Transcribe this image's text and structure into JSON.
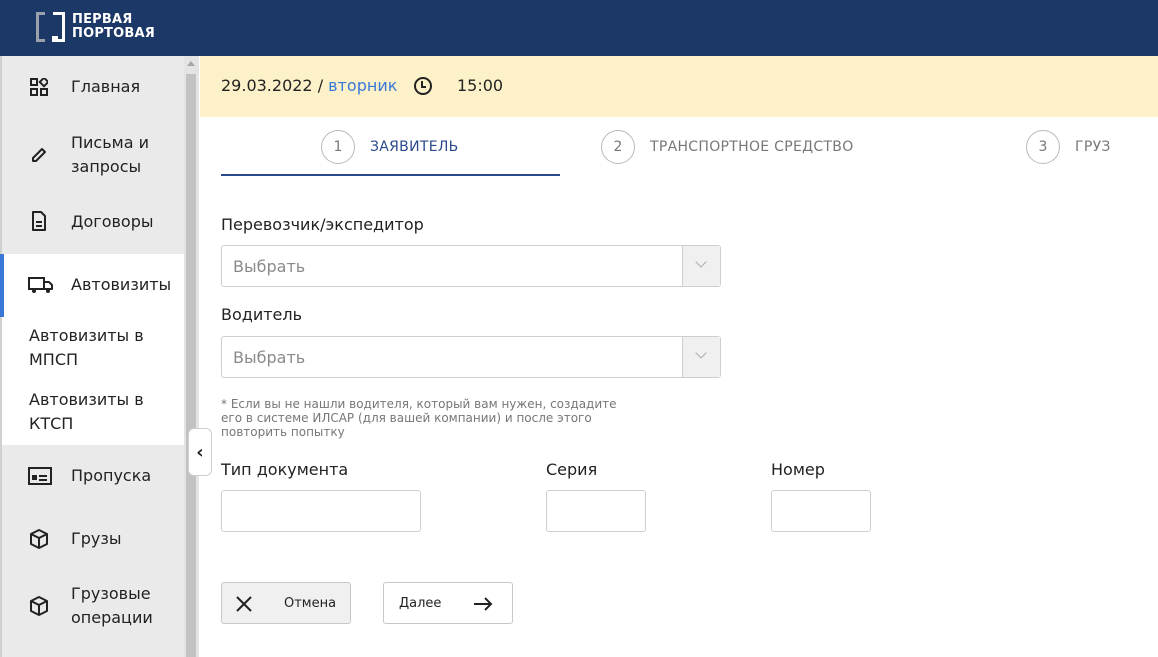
{
  "brand": {
    "line1": "ПЕРВАЯ",
    "line2": "ПОРТОВАЯ"
  },
  "sidebar": {
    "items": [
      {
        "label": "Главная",
        "icon": "grid-icon"
      },
      {
        "label": "Письма и запросы",
        "icon": "pencil-icon"
      },
      {
        "label": "Договоры",
        "icon": "document-icon"
      },
      {
        "label": "Автовизиты",
        "icon": "truck-icon",
        "active": true
      },
      {
        "label": "Пропуска",
        "icon": "pass-card-icon"
      },
      {
        "label": "Грузы",
        "icon": "box-icon"
      },
      {
        "label": "Грузовые операции",
        "icon": "box-icon"
      }
    ],
    "subitems": [
      {
        "label": "Автовизиты в МПСП"
      },
      {
        "label": "Автовизиты в КТСП"
      }
    ],
    "collapse_glyph": "‹"
  },
  "header": {
    "date": "29.03.2022",
    "separator": " / ",
    "weekday": "вторник",
    "time": "15:00"
  },
  "steps": [
    {
      "num": "1",
      "label": "ЗАЯВИТЕЛЬ",
      "active": true
    },
    {
      "num": "2",
      "label": "ТРАНСПОРТНОЕ СРЕДСТВО"
    },
    {
      "num": "3",
      "label": "ГРУЗ"
    }
  ],
  "form": {
    "carrier": {
      "label": "Перевозчик/экспедитор",
      "placeholder": "Выбрать"
    },
    "driver": {
      "label": "Водитель",
      "placeholder": "Выбрать"
    },
    "hint": "* Если вы не нашли водителя, который вам нужен, создадите его в системе ИЛСАР (для вашей компании) и после этого повторить попытку",
    "doc_type": {
      "label": "Тип документа",
      "value": ""
    },
    "series": {
      "label": "Серия",
      "value": ""
    },
    "number": {
      "label": "Номер",
      "value": ""
    }
  },
  "buttons": {
    "cancel": "Отмена",
    "next": "Далее"
  },
  "colors": {
    "topbar": "#1c3867",
    "accent": "#3a78d8",
    "date_bar": "#fdf1c9",
    "step_active": "#2b4a8a"
  }
}
